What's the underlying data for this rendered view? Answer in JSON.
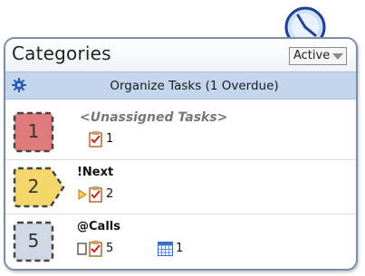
{
  "header": {
    "title": "Categories"
  },
  "view_select": {
    "value": "Active"
  },
  "organize": {
    "label": "Organize Tasks (1 Overdue)"
  },
  "categories": [
    {
      "name": "<Unassigned Tasks>",
      "badge": "1",
      "badge_color": "#e07b7b",
      "task_count": "1"
    },
    {
      "name": "!Next",
      "badge": "2",
      "badge_color": "#f5d66b",
      "task_count": "2"
    },
    {
      "name": "@Calls",
      "badge": "5",
      "badge_color": "#cfd8e3",
      "task_count": "5",
      "calendar_count": "1"
    }
  ],
  "icons": {
    "clock": "clock-icon",
    "gear": "gear-icon",
    "task": "task-checklist-icon",
    "calendar": "calendar-icon",
    "expand": "expand-arrow-icon",
    "checkbox": "checkbox-icon"
  }
}
